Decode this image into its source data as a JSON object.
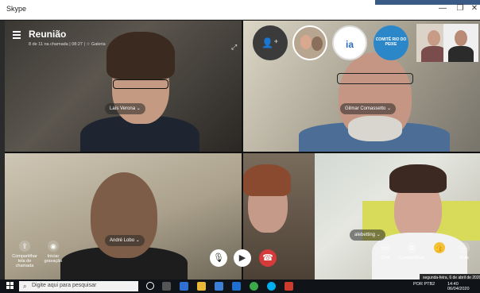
{
  "window": {
    "title": "Skype"
  },
  "call": {
    "title": "Reunião",
    "subtitle": "8 de 11 na chamada | 08:27 | ☆ Galeria"
  },
  "participants": {
    "top_left": "Laís Verona",
    "top_right": "Gilmar Comassetto",
    "bottom_left": "André Lobo",
    "bottom_right": "alebetting"
  },
  "avatars": {
    "ia_label": "ia",
    "comite_label": "COMITÊ RIO DO PEIXE"
  },
  "controls": {
    "share_label": "Compartilhar tela de chamada",
    "record_label": "Iniciar gravação",
    "chat_label": "Chat",
    "share2_label": "Compartilhar",
    "more_label": "Mais"
  },
  "taskbar": {
    "search_placeholder": "Digite aqui para pesquisar",
    "language": "POR PTB2",
    "time": "14:40",
    "date": "06/04/2020",
    "date_tooltip": "segunda-feira, 6 de abril de 2020"
  },
  "colors": {
    "end_call": "#d63a3a",
    "accent": "#2c87c9"
  }
}
